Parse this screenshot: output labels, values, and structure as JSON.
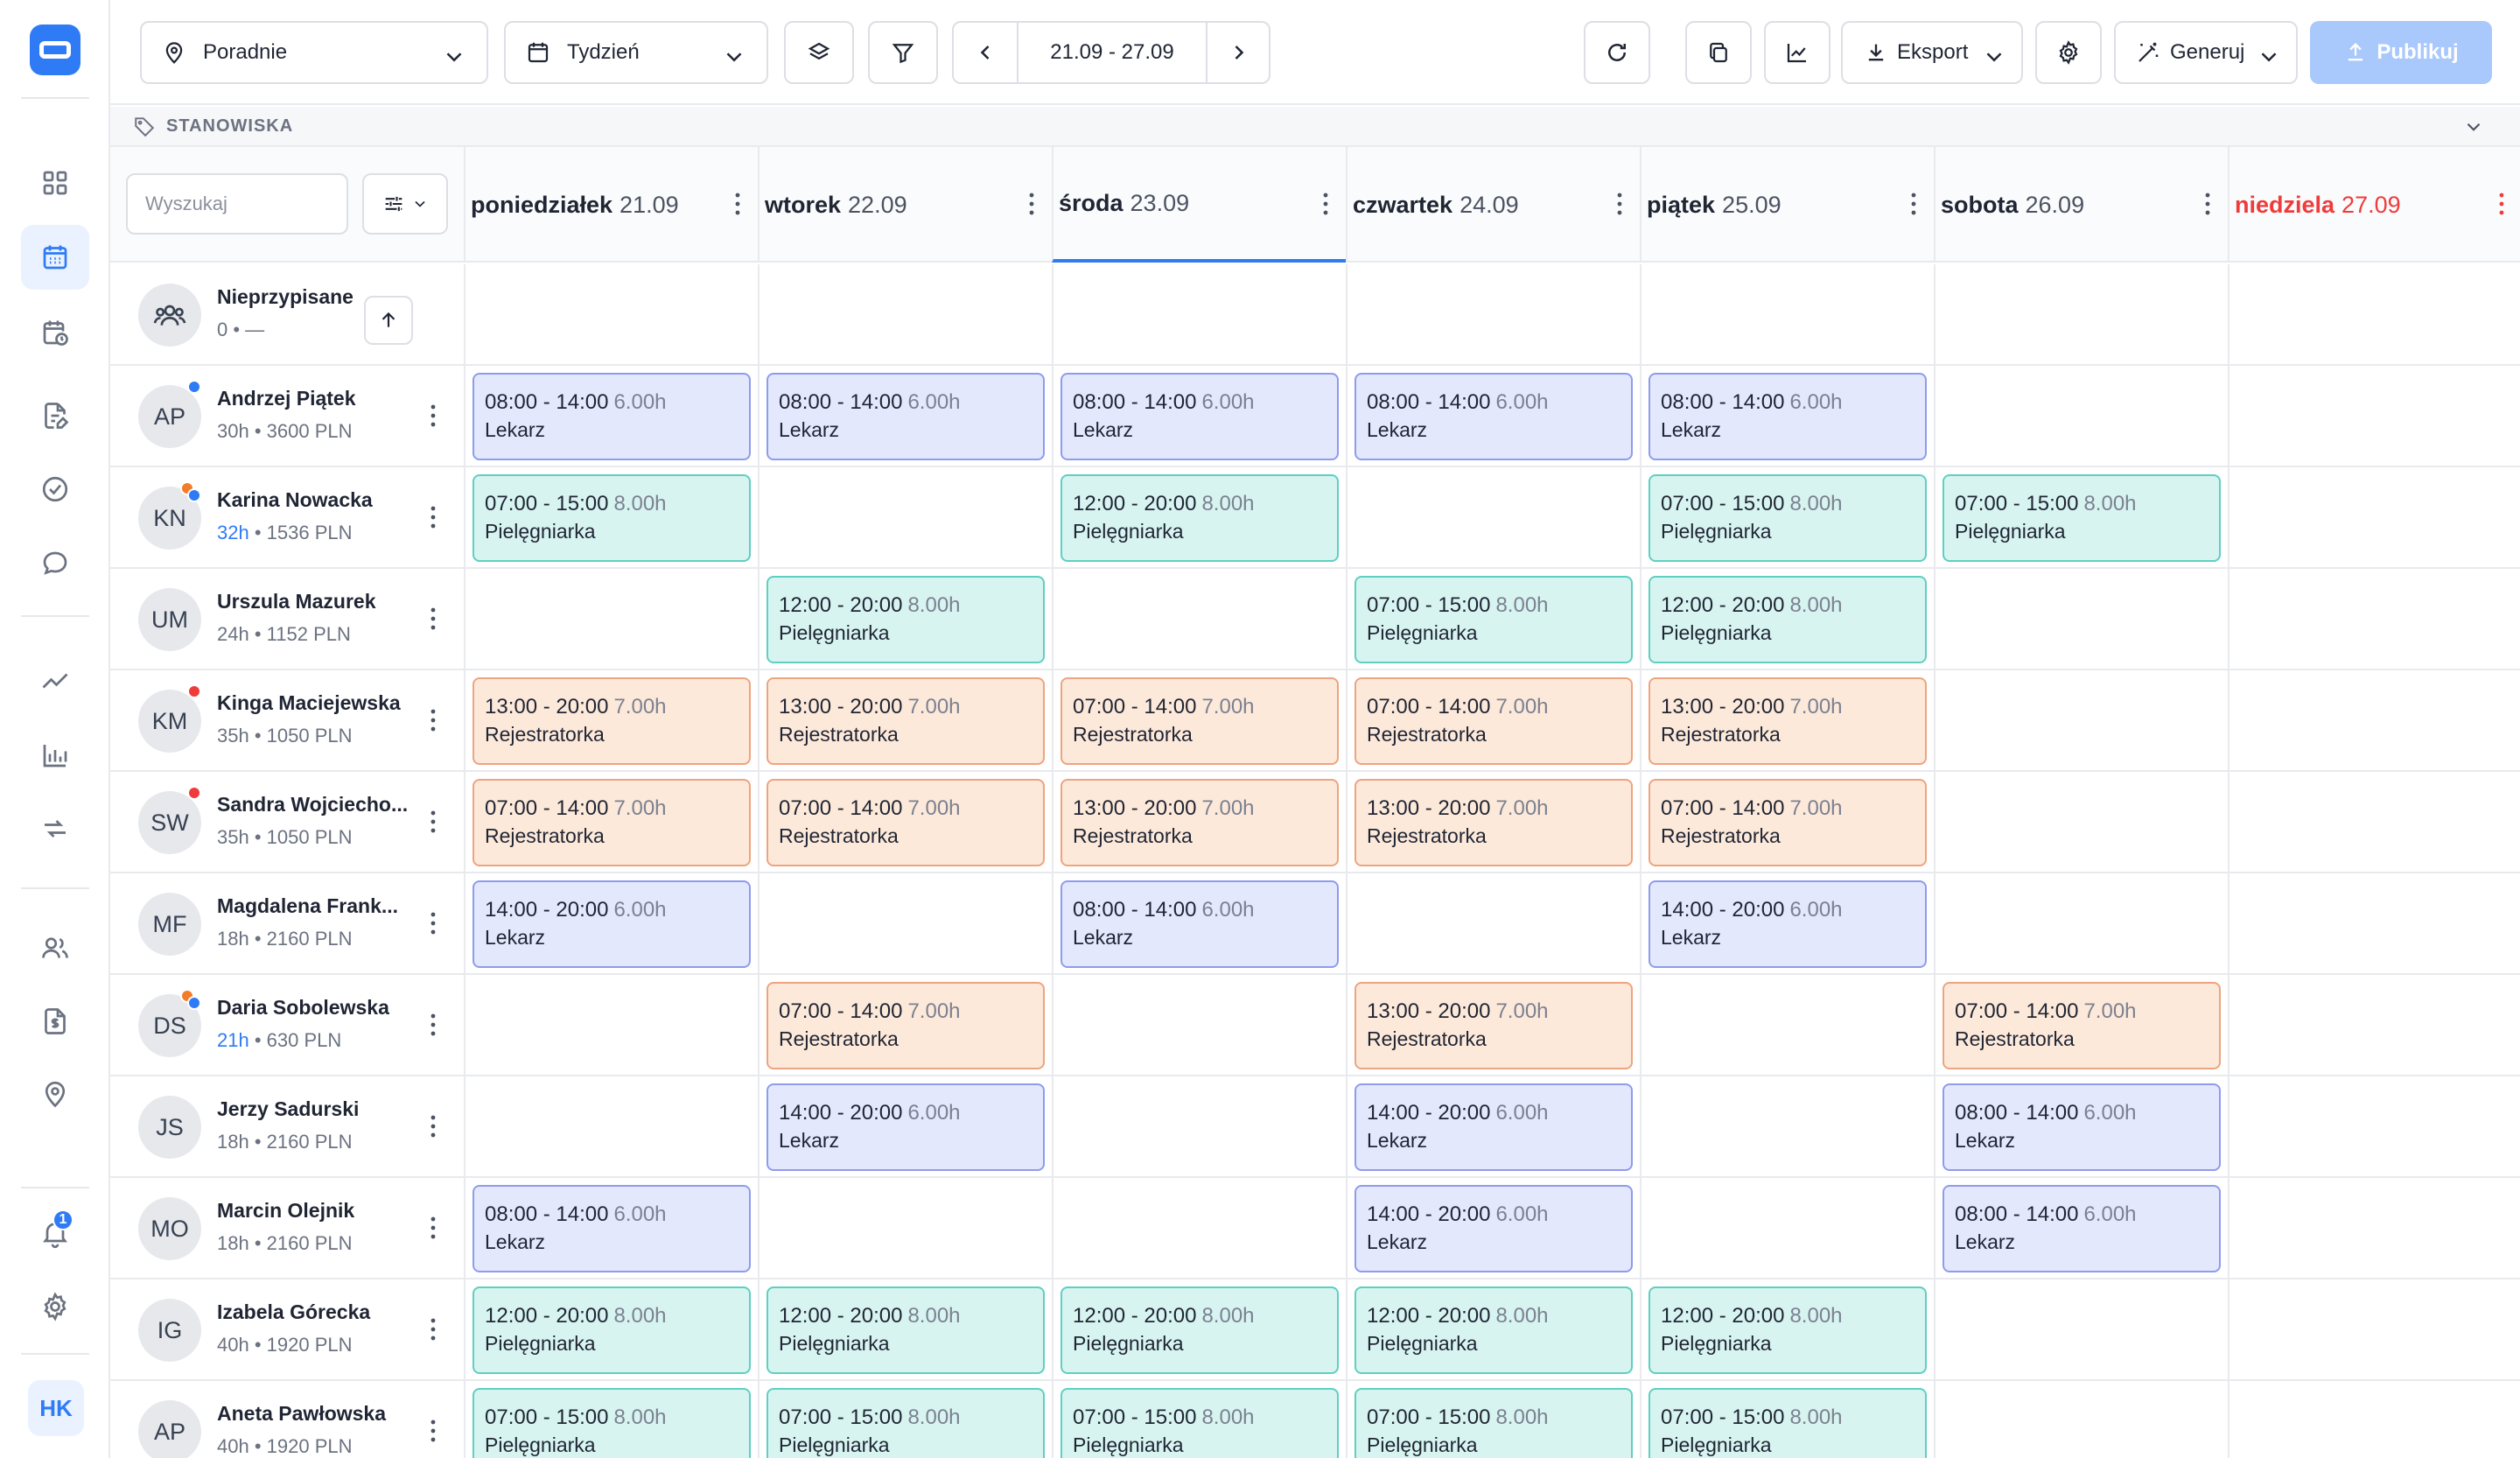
{
  "sidebar": {
    "notification_count": "1",
    "user_initials": "HK"
  },
  "toolbar": {
    "location": "Poradnie",
    "period": "Tydzień",
    "date_range": "21.09 - 27.09",
    "export_label": "Eksport",
    "generate_label": "Generuj",
    "publish_label": "Publikuj"
  },
  "section": {
    "title": "STANOWISKA"
  },
  "search": {
    "placeholder": "Wyszukaj"
  },
  "days": [
    {
      "name": "poniedziałek",
      "date": "21.09"
    },
    {
      "name": "wtorek",
      "date": "22.09"
    },
    {
      "name": "środa",
      "date": "23.09"
    },
    {
      "name": "czwartek",
      "date": "24.09"
    },
    {
      "name": "piątek",
      "date": "25.09"
    },
    {
      "name": "sobota",
      "date": "26.09"
    },
    {
      "name": "niedziela",
      "date": "27.09"
    }
  ],
  "unassigned": {
    "name": "Nieprzypisane",
    "meta": "0 • —"
  },
  "roles": {
    "lek": "Lekarz",
    "piel": "Pielęgniarka",
    "rej": "Rejestratorka"
  },
  "colors": {
    "accent": "#2f7bf5",
    "sunday": "#ef3b3b",
    "lekarz": "#e3e8fd",
    "pielegniarka": "#d7f4f1",
    "rejestratorka": "#fde9da",
    "dot_red": "#ef3b3b",
    "dot_orange": "#f47b2a",
    "dot_blue": "#2f7bf5"
  },
  "employees": [
    {
      "initials": "AP",
      "name": "Andrzej Piątek",
      "hours": "30h",
      "pay": "3600 PLN",
      "hours_highlight": false,
      "dots": [
        "blue"
      ],
      "shifts": [
        {
          "day": 0,
          "time": "08:00 - 14:00",
          "dur": "6.00h",
          "role": "lek"
        },
        {
          "day": 1,
          "time": "08:00 - 14:00",
          "dur": "6.00h",
          "role": "lek"
        },
        {
          "day": 2,
          "time": "08:00 - 14:00",
          "dur": "6.00h",
          "role": "lek"
        },
        {
          "day": 3,
          "time": "08:00 - 14:00",
          "dur": "6.00h",
          "role": "lek"
        },
        {
          "day": 4,
          "time": "08:00 - 14:00",
          "dur": "6.00h",
          "role": "lek"
        }
      ]
    },
    {
      "initials": "KN",
      "name": "Karina Nowacka",
      "hours": "32h",
      "pay": "1536 PLN",
      "hours_highlight": true,
      "dots": [
        "orange",
        "blue"
      ],
      "shifts": [
        {
          "day": 0,
          "time": "07:00 - 15:00",
          "dur": "8.00h",
          "role": "piel"
        },
        {
          "day": 2,
          "time": "12:00 - 20:00",
          "dur": "8.00h",
          "role": "piel"
        },
        {
          "day": 4,
          "time": "07:00 - 15:00",
          "dur": "8.00h",
          "role": "piel"
        },
        {
          "day": 5,
          "time": "07:00 - 15:00",
          "dur": "8.00h",
          "role": "piel"
        }
      ]
    },
    {
      "initials": "UM",
      "name": "Urszula Mazurek",
      "hours": "24h",
      "pay": "1152 PLN",
      "hours_highlight": false,
      "dots": [],
      "shifts": [
        {
          "day": 1,
          "time": "12:00 - 20:00",
          "dur": "8.00h",
          "role": "piel"
        },
        {
          "day": 3,
          "time": "07:00 - 15:00",
          "dur": "8.00h",
          "role": "piel"
        },
        {
          "day": 4,
          "time": "12:00 - 20:00",
          "dur": "8.00h",
          "role": "piel"
        }
      ]
    },
    {
      "initials": "KM",
      "name": "Kinga Maciejewska",
      "hours": "35h",
      "pay": "1050 PLN",
      "hours_highlight": false,
      "dots": [
        "red"
      ],
      "shifts": [
        {
          "day": 0,
          "time": "13:00 - 20:00",
          "dur": "7.00h",
          "role": "rej"
        },
        {
          "day": 1,
          "time": "13:00 - 20:00",
          "dur": "7.00h",
          "role": "rej"
        },
        {
          "day": 2,
          "time": "07:00 - 14:00",
          "dur": "7.00h",
          "role": "rej"
        },
        {
          "day": 3,
          "time": "07:00 - 14:00",
          "dur": "7.00h",
          "role": "rej"
        },
        {
          "day": 4,
          "time": "13:00 - 20:00",
          "dur": "7.00h",
          "role": "rej"
        }
      ]
    },
    {
      "initials": "SW",
      "name": "Sandra Wojciecho...",
      "hours": "35h",
      "pay": "1050 PLN",
      "hours_highlight": false,
      "dots": [
        "red"
      ],
      "shifts": [
        {
          "day": 0,
          "time": "07:00 - 14:00",
          "dur": "7.00h",
          "role": "rej"
        },
        {
          "day": 1,
          "time": "07:00 - 14:00",
          "dur": "7.00h",
          "role": "rej"
        },
        {
          "day": 2,
          "time": "13:00 - 20:00",
          "dur": "7.00h",
          "role": "rej"
        },
        {
          "day": 3,
          "time": "13:00 - 20:00",
          "dur": "7.00h",
          "role": "rej"
        },
        {
          "day": 4,
          "time": "07:00 - 14:00",
          "dur": "7.00h",
          "role": "rej"
        }
      ]
    },
    {
      "initials": "MF",
      "name": "Magdalena Frank...",
      "hours": "18h",
      "pay": "2160 PLN",
      "hours_highlight": false,
      "dots": [],
      "shifts": [
        {
          "day": 0,
          "time": "14:00 - 20:00",
          "dur": "6.00h",
          "role": "lek"
        },
        {
          "day": 2,
          "time": "08:00 - 14:00",
          "dur": "6.00h",
          "role": "lek"
        },
        {
          "day": 4,
          "time": "14:00 - 20:00",
          "dur": "6.00h",
          "role": "lek"
        }
      ]
    },
    {
      "initials": "DS",
      "name": "Daria Sobolewska",
      "hours": "21h",
      "pay": "630 PLN",
      "hours_highlight": true,
      "dots": [
        "orange",
        "blue"
      ],
      "shifts": [
        {
          "day": 1,
          "time": "07:00 - 14:00",
          "dur": "7.00h",
          "role": "rej"
        },
        {
          "day": 3,
          "time": "13:00 - 20:00",
          "dur": "7.00h",
          "role": "rej"
        },
        {
          "day": 5,
          "time": "07:00 - 14:00",
          "dur": "7.00h",
          "role": "rej"
        }
      ]
    },
    {
      "initials": "JS",
      "name": "Jerzy Sadurski",
      "hours": "18h",
      "pay": "2160 PLN",
      "hours_highlight": false,
      "dots": [],
      "shifts": [
        {
          "day": 1,
          "time": "14:00 - 20:00",
          "dur": "6.00h",
          "role": "lek"
        },
        {
          "day": 3,
          "time": "14:00 - 20:00",
          "dur": "6.00h",
          "role": "lek"
        },
        {
          "day": 5,
          "time": "08:00 - 14:00",
          "dur": "6.00h",
          "role": "lek"
        }
      ]
    },
    {
      "initials": "MO",
      "name": "Marcin Olejnik",
      "hours": "18h",
      "pay": "2160 PLN",
      "hours_highlight": false,
      "dots": [],
      "shifts": [
        {
          "day": 0,
          "time": "08:00 - 14:00",
          "dur": "6.00h",
          "role": "lek"
        },
        {
          "day": 3,
          "time": "14:00 - 20:00",
          "dur": "6.00h",
          "role": "lek"
        },
        {
          "day": 5,
          "time": "08:00 - 14:00",
          "dur": "6.00h",
          "role": "lek"
        }
      ]
    },
    {
      "initials": "IG",
      "name": "Izabela Górecka",
      "hours": "40h",
      "pay": "1920 PLN",
      "hours_highlight": false,
      "dots": [],
      "shifts": [
        {
          "day": 0,
          "time": "12:00 - 20:00",
          "dur": "8.00h",
          "role": "piel"
        },
        {
          "day": 1,
          "time": "12:00 - 20:00",
          "dur": "8.00h",
          "role": "piel"
        },
        {
          "day": 2,
          "time": "12:00 - 20:00",
          "dur": "8.00h",
          "role": "piel"
        },
        {
          "day": 3,
          "time": "12:00 - 20:00",
          "dur": "8.00h",
          "role": "piel"
        },
        {
          "day": 4,
          "time": "12:00 - 20:00",
          "dur": "8.00h",
          "role": "piel"
        }
      ]
    },
    {
      "initials": "AP",
      "name": "Aneta Pawłowska",
      "hours": "40h",
      "pay": "1920 PLN",
      "hours_highlight": false,
      "dots": [],
      "shifts": [
        {
          "day": 0,
          "time": "07:00 - 15:00",
          "dur": "8.00h",
          "role": "piel"
        },
        {
          "day": 1,
          "time": "07:00 - 15:00",
          "dur": "8.00h",
          "role": "piel"
        },
        {
          "day": 2,
          "time": "07:00 - 15:00",
          "dur": "8.00h",
          "role": "piel"
        },
        {
          "day": 3,
          "time": "07:00 - 15:00",
          "dur": "8.00h",
          "role": "piel"
        },
        {
          "day": 4,
          "time": "07:00 - 15:00",
          "dur": "8.00h",
          "role": "piel"
        }
      ]
    }
  ]
}
